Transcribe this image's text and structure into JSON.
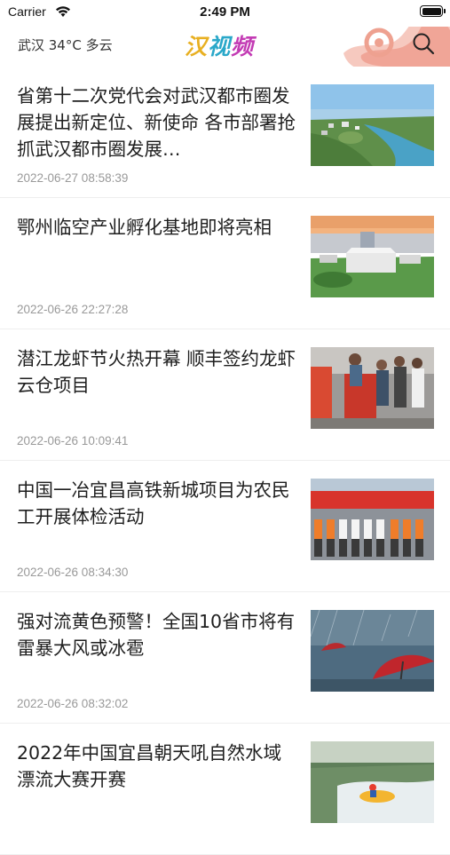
{
  "status_bar": {
    "carrier": "Carrier",
    "time": "2:49 PM"
  },
  "header": {
    "weather": "武汉 34°C 多云",
    "logo_chars": [
      "汉",
      "视",
      "频"
    ]
  },
  "news": [
    {
      "title": "省第十二次党代会对武汉都市圈发展提出新定位、新使命 各市部署抢抓武汉都市圈发展…",
      "time": "2022-06-27 08:58:39",
      "thumb": "aerial-city-image"
    },
    {
      "title": "鄂州临空产业孵化基地即将亮相",
      "time": "2022-06-26 22:27:28",
      "thumb": "industrial-building-image"
    },
    {
      "title": "潜江龙虾节火热开幕 顺丰签约龙虾云仓项目",
      "time": "2022-06-26 10:09:41",
      "thumb": "crayfish-festival-image"
    },
    {
      "title": "中国一冶宜昌高铁新城项目为农民工开展体检活动",
      "time": "2022-06-26 08:34:30",
      "thumb": "workers-group-image"
    },
    {
      "title": "强对流黄色预警！全国10省市将有雷暴大风或冰雹",
      "time": "2022-06-26 08:32:02",
      "thumb": "storm-umbrella-image"
    },
    {
      "title": "2022年中国宜昌朝天吼自然水域漂流大赛开赛",
      "time": "",
      "thumb": "rafting-image"
    }
  ]
}
